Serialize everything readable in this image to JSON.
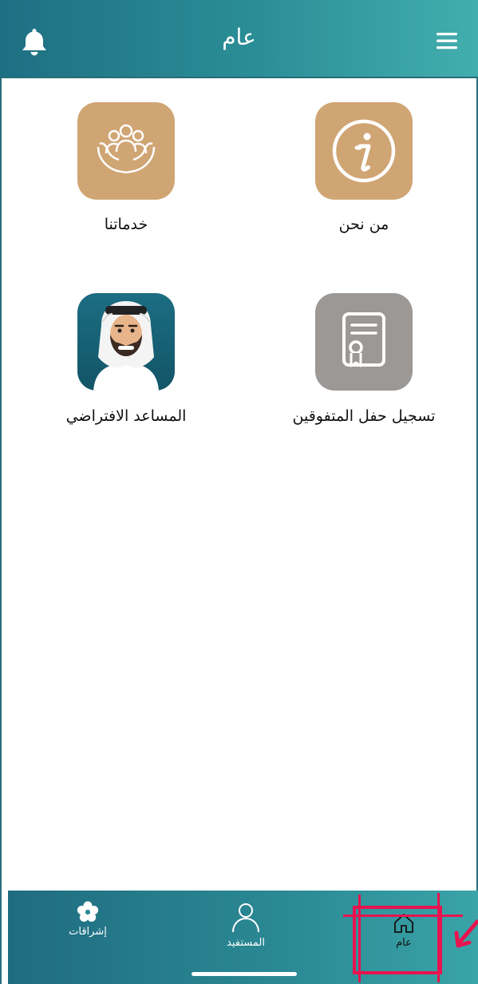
{
  "header": {
    "title": "عام"
  },
  "tiles": [
    {
      "label": "من نحن",
      "icon": "info-icon",
      "color": "#d0a574"
    },
    {
      "label": "خدماتنا",
      "icon": "people-in-hands-icon",
      "color": "#d0a574"
    },
    {
      "label": "تسجيل حفل المتفوقين",
      "icon": "certificate-icon",
      "color": "#9c9896"
    },
    {
      "label": "المساعد الافتراضي",
      "icon": "virtual-assistant-avatar",
      "color": "#1c6d83"
    }
  ],
  "bottom_nav": {
    "items": [
      {
        "label": "إشراقات",
        "icon": "flower-icon"
      },
      {
        "label": "المستفيد",
        "icon": "user-icon"
      },
      {
        "label": "عام",
        "icon": "home-icon",
        "active": true
      }
    ]
  },
  "colors": {
    "header_gradient_start": "#1e6f83",
    "header_gradient_end": "#43aeae",
    "tile_gold": "#d0a574",
    "tile_gray": "#9c9896",
    "annotation_red": "#e8134f"
  }
}
